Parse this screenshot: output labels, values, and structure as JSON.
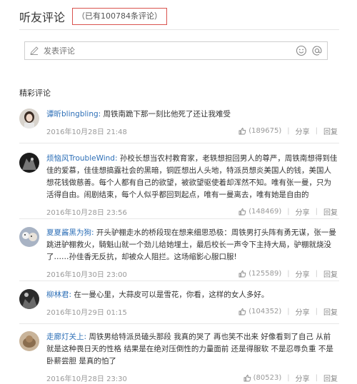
{
  "header": {
    "title": "听友评论",
    "count": "（已有100784条评论）"
  },
  "compose": {
    "placeholder": "发表评论"
  },
  "section_title": "精彩评论",
  "comments": [
    {
      "user": "谭昕blingbling:",
      "text": " 周铁南跪下那一刻比他死了还让我难受",
      "time": "2016年10月28日 21:48",
      "likes": "(189675)",
      "share": "分享",
      "reply": "回复"
    },
    {
      "user": "烦恼风TroubleWind:",
      "text": " 孙校长想当农村教育家，老轶想担回男人的尊严，周铁南想得到佳佳的爱慕，佳佳想搞露社会的黑暗，铜匠想出人头地，特派员想炎美国人的钱，美国人想花钱做慈善。每个人都有自己的欲望，被欲望驱使着却浑然不知。唯有张一曼，只为活得自由。闹剧结束，每个人似乎都回到起点，唯有一曼离去，唯有她是自由的",
      "time": "2016年10月28日 23:56",
      "likes": "(148469)",
      "share": "分享",
      "reply": "回复"
    },
    {
      "user": "夏夏酱黑为狗:",
      "text": " 开头驴棚走水的桥段现在想来细思恐极：周铁男打头阵有勇无谋，张一曼跳进驴棚救火，騎魁山就一个劲儿给她埋土，最后校长一声令下主持大局，驴棚就烧没了……孙佳香无反抗，却被众人阻拦。这场缩影心服口服!",
      "time": "2016年10月30日 23:00",
      "likes": "(125589)",
      "share": "分享",
      "reply": "回复"
    },
    {
      "user": "柳林君:",
      "text": " 在一曼心里，大蒜皮可以是雪花，你看，这样的女人多好。",
      "time": "2016年10月29日 01:15",
      "likes": "(104352)",
      "share": "分享",
      "reply": "回复"
    },
    {
      "user": "走廊灯关上:",
      "text": " 周铁男给特派员磕头那段 我真的哭了 再也笑不出来 好像看到了自己 从前就是这种畏日天的性格 结果是在绝对压倒性的力量面前 还是得服软 不是忍辱负重 不是卧薪尝胆 是真的怕了",
      "time": "2016年10月28日 23:30",
      "likes": "(80523)",
      "share": "分享",
      "reply": "回复"
    }
  ],
  "colors": {
    "username": "#2d6fb7",
    "count_border": "#d9534f"
  }
}
